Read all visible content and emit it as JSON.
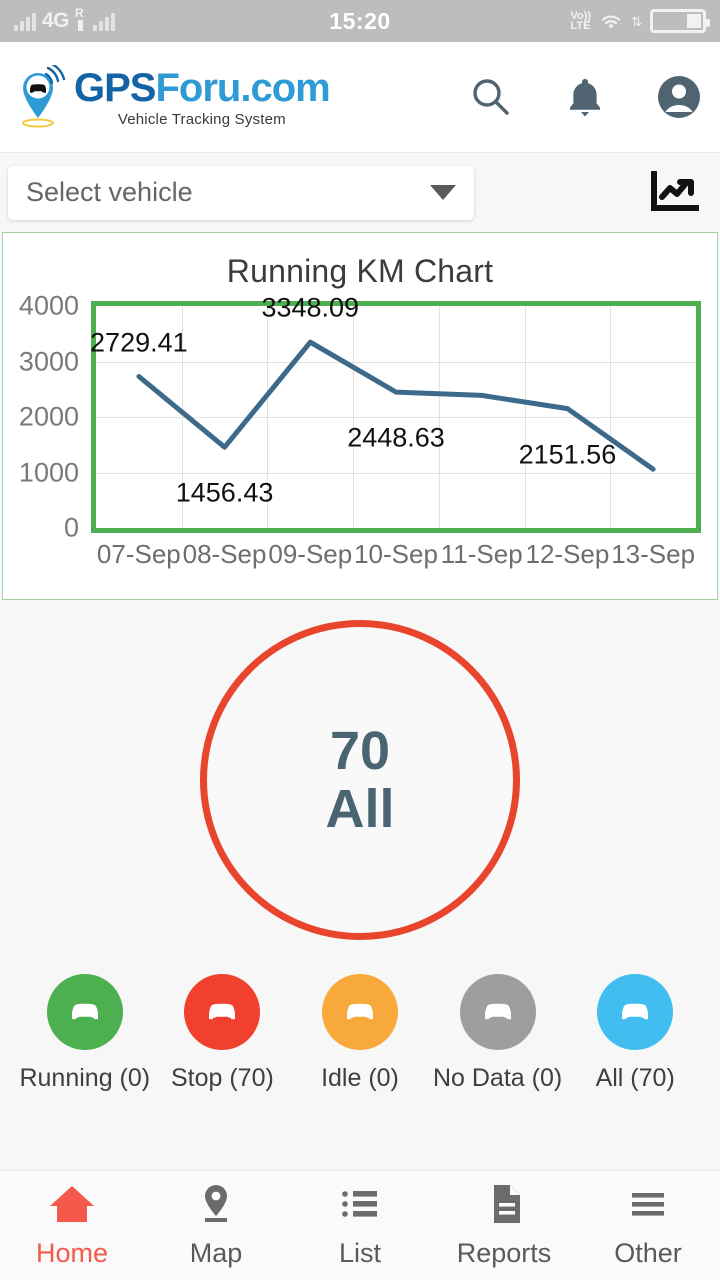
{
  "status_bar": {
    "network": "4G",
    "roaming": "R",
    "time": "15:20",
    "volte_line1": "Vo))",
    "volte_line2": "LTE",
    "signal_icon": "signal-bars-icon",
    "wifi_icon": "wifi-icon",
    "data_icon": "data-transfer-icon",
    "battery_icon": "battery-icon",
    "battery_level": 30
  },
  "header": {
    "brand_part1": "GPS",
    "brand_part2": "Foru.com",
    "tagline": "Vehicle Tracking System",
    "logo_icon": "gps-pin-car-logo",
    "search_icon": "search-icon",
    "notification_icon": "bell-icon",
    "account_icon": "account-circle-icon",
    "brand_color_dark": "#1464a5",
    "brand_color_light": "#2e9bd6"
  },
  "toolbar": {
    "vehicle_select_label": "Select vehicle",
    "vehicle_select_placeholder": "Select vehicle",
    "dropdown_icon": "chevron-down-icon",
    "chart_toggle_icon": "trending-chart-icon"
  },
  "chart_data": {
    "type": "line",
    "title": "Running KM Chart",
    "categories": [
      "07-Sep",
      "08-Sep",
      "09-Sep",
      "10-Sep",
      "11-Sep",
      "12-Sep",
      "13-Sep"
    ],
    "values": [
      2729.41,
      1456.43,
      3348.09,
      2448.63,
      2390.0,
      2151.56,
      1060.0
    ],
    "point_labels": [
      "2729.41",
      "1456.43",
      "3348.09",
      "2448.63",
      "",
      "2151.56",
      ""
    ],
    "label_positions": [
      "above",
      "below",
      "above",
      "below",
      "",
      "below",
      ""
    ],
    "xlabel": "",
    "ylabel": "",
    "ylim": [
      0,
      4000
    ],
    "yticks": [
      0,
      1000,
      2000,
      3000,
      4000
    ],
    "ytick_labels": [
      "0",
      "1000",
      "2000",
      "3000",
      "4000"
    ],
    "grid": true,
    "legend": false,
    "line_color": "#3d6a8a",
    "plot_border_color": "#4caf50",
    "card_border_color": "#9fd49f"
  },
  "gauge": {
    "value": "70",
    "label": "All",
    "ring_color": "#e8452c",
    "text_color": "#4a6572"
  },
  "status_chips": [
    {
      "label": "Running (0)",
      "name": "running",
      "color": "#4caf50",
      "icon": "car-icon"
    },
    {
      "label": "Stop (70)",
      "name": "stop",
      "color": "#f2402e",
      "icon": "car-icon"
    },
    {
      "label": "Idle (0)",
      "name": "idle",
      "color": "#f7a93b",
      "icon": "car-icon"
    },
    {
      "label": "No Data (0)",
      "name": "no-data",
      "color": "#9e9e9e",
      "icon": "car-icon"
    },
    {
      "label": "All (70)",
      "name": "all",
      "color": "#41bdf0",
      "icon": "car-icon"
    }
  ],
  "tabs": [
    {
      "label": "Home",
      "icon": "home-icon",
      "active": true
    },
    {
      "label": "Map",
      "icon": "map-pin-icon",
      "active": false
    },
    {
      "label": "List",
      "icon": "list-icon",
      "active": false
    },
    {
      "label": "Reports",
      "icon": "document-icon",
      "active": false
    },
    {
      "label": "Other",
      "icon": "menu-icon",
      "active": false
    }
  ]
}
